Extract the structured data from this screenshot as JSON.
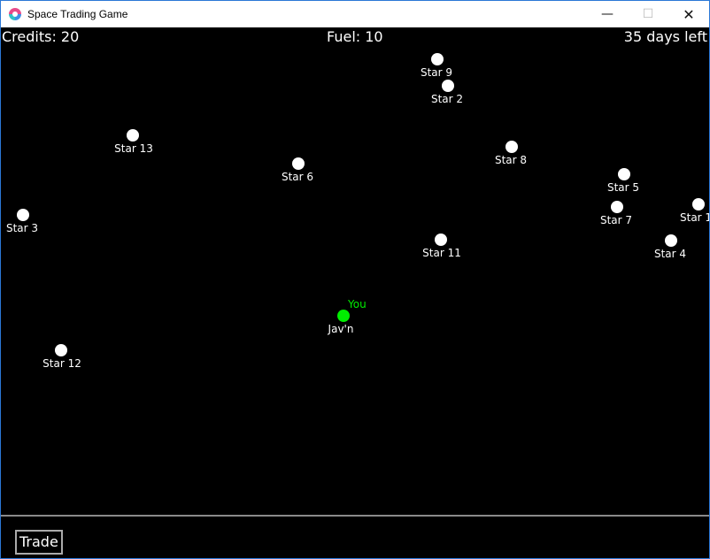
{
  "window": {
    "title": "Space Trading Game",
    "minimize_glyph": "—",
    "maximize_glyph": "☐",
    "close_glyph": "✕"
  },
  "hud": {
    "credits": "Credits: 20",
    "fuel": "Fuel: 10",
    "days": "35 days left"
  },
  "you_label": "You",
  "current_star": "Jav'n",
  "stars": [
    "Star 9",
    "Star 2",
    "Star 13",
    "Star 6",
    "Star 8",
    "Star 5",
    "Star 7",
    "Star 1",
    "Star 3",
    "Star 11",
    "Star 4",
    "Jav'n",
    "Star 12"
  ],
  "trade_button": "Trade",
  "colors": {
    "star": "#ffffff",
    "current_star": "#00ee00",
    "background": "#000000"
  }
}
